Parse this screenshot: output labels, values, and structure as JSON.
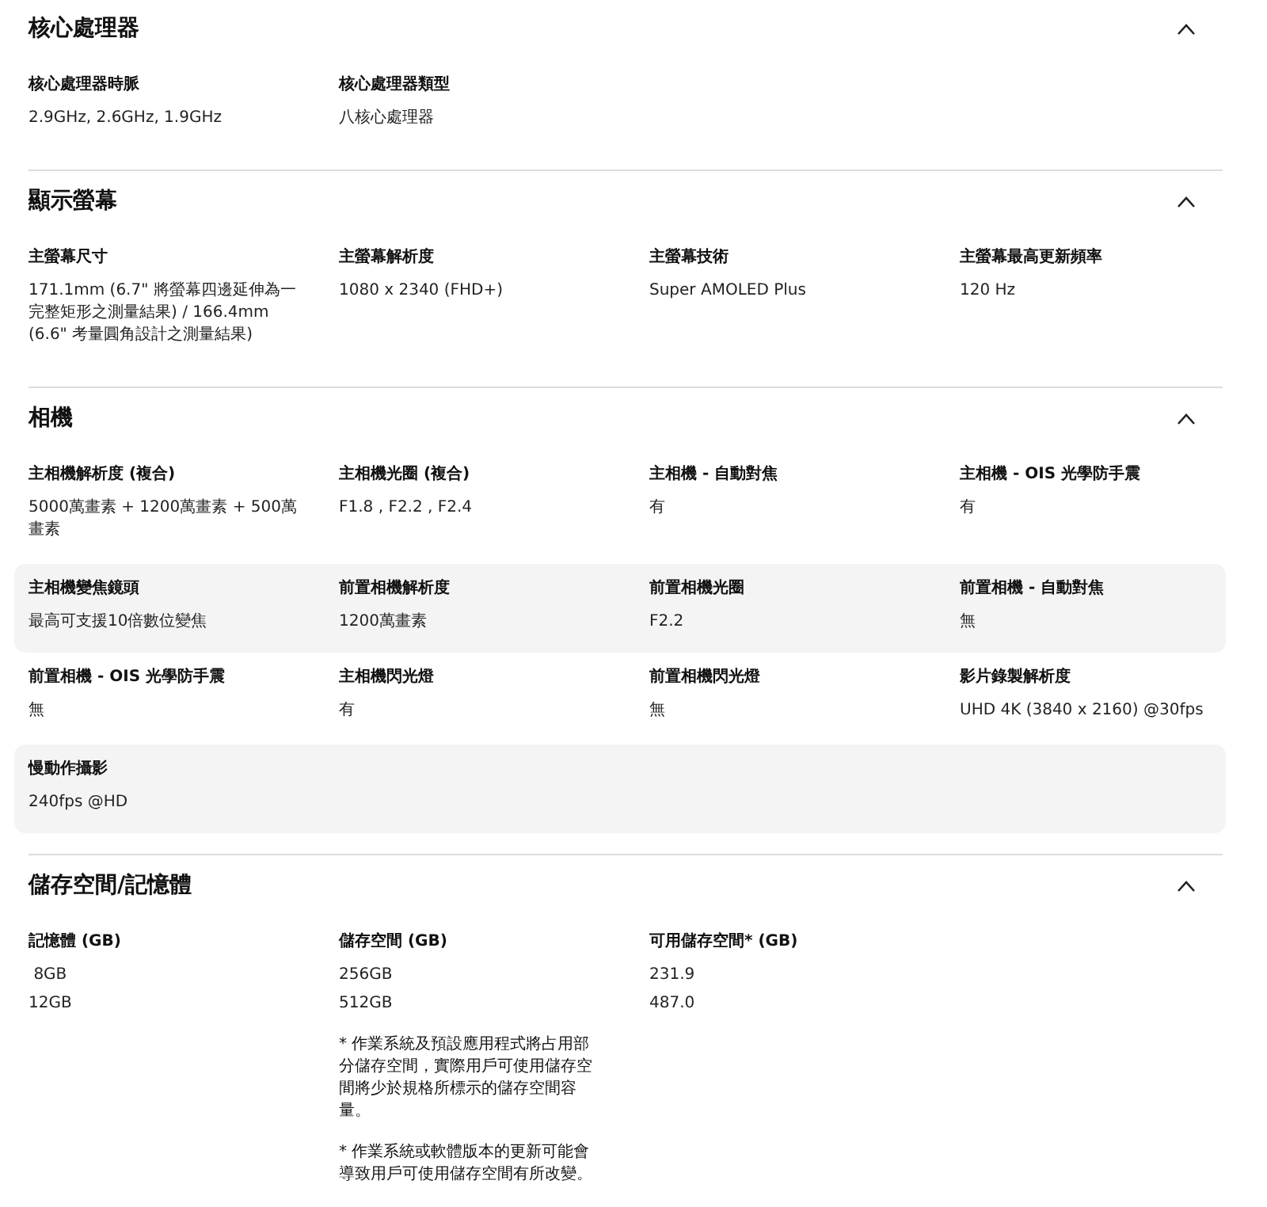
{
  "sections": [
    {
      "title": "核心處理器",
      "expanded": true,
      "rows": [
        {
          "shaded": false,
          "items": [
            {
              "label": "核心處理器時脈",
              "values": [
                "2.9GHz, 2.6GHz, 1.9GHz"
              ]
            },
            {
              "label": "核心處理器類型",
              "values": [
                "八核心處理器"
              ]
            }
          ]
        }
      ]
    },
    {
      "title": "顯示螢幕",
      "expanded": true,
      "rows": [
        {
          "shaded": false,
          "items": [
            {
              "label": "主螢幕尺寸",
              "values": [
                "171.1mm (6.7\" 將螢幕四邊延伸為一完整矩形之測量結果) / 166.4mm (6.6\" 考量圓角設計之測量結果)"
              ]
            },
            {
              "label": "主螢幕解析度",
              "values": [
                "1080 x 2340 (FHD+)"
              ]
            },
            {
              "label": "主螢幕技術",
              "values": [
                "Super AMOLED Plus"
              ]
            },
            {
              "label": "主螢幕最高更新頻率",
              "values": [
                "120 Hz"
              ]
            }
          ]
        }
      ]
    },
    {
      "title": "相機",
      "expanded": true,
      "rows": [
        {
          "shaded": false,
          "items": [
            {
              "label": "主相機解析度 (複合)",
              "values": [
                "5000萬畫素 + 1200萬畫素 + 500萬畫素"
              ]
            },
            {
              "label": "主相機光圈 (複合)",
              "values": [
                "F1.8 , F2.2 , F2.4"
              ]
            },
            {
              "label": "主相機 - 自動對焦",
              "values": [
                "有"
              ]
            },
            {
              "label": "主相機 - OIS 光學防手震",
              "values": [
                "有"
              ]
            }
          ]
        },
        {
          "shaded": true,
          "items": [
            {
              "label": "主相機變焦鏡頭",
              "values": [
                "最高可支援10倍數位變焦"
              ]
            },
            {
              "label": "前置相機解析度",
              "values": [
                "1200萬畫素"
              ]
            },
            {
              "label": "前置相機光圈",
              "values": [
                "F2.2"
              ]
            },
            {
              "label": "前置相機 - 自動對焦",
              "values": [
                "無"
              ]
            }
          ]
        },
        {
          "shaded": false,
          "items": [
            {
              "label": "前置相機 - OIS 光學防手震",
              "values": [
                "無"
              ]
            },
            {
              "label": "主相機閃光燈",
              "values": [
                "有"
              ]
            },
            {
              "label": "前置相機閃光燈",
              "values": [
                "無"
              ]
            },
            {
              "label": "影片錄製解析度",
              "values": [
                "UHD 4K (3840 x 2160) @30fps"
              ]
            }
          ]
        },
        {
          "shaded": true,
          "items": [
            {
              "label": "慢動作攝影",
              "values": [
                "240fps @HD"
              ]
            }
          ]
        }
      ]
    },
    {
      "title": "儲存空間/記憶體",
      "expanded": true,
      "rows": [
        {
          "shaded": false,
          "items": [
            {
              "label": "記憶體 (GB)",
              "values": [
                " 8GB",
                "12GB"
              ]
            },
            {
              "label": "儲存空間 (GB)",
              "values": [
                "256GB",
                "512GB"
              ],
              "notes": [
                "* 作業系統及預設應用程式將占用部分儲存空間，實際用戶可使用儲存空間將少於規格所標示的儲存空間容量。",
                "* 作業系統或軟體版本的更新可能會導致用戶可使用儲存空間有所改變。"
              ]
            },
            {
              "label": "可用儲存空間* (GB)",
              "values": [
                "231.9",
                "487.0"
              ]
            }
          ]
        }
      ]
    }
  ]
}
